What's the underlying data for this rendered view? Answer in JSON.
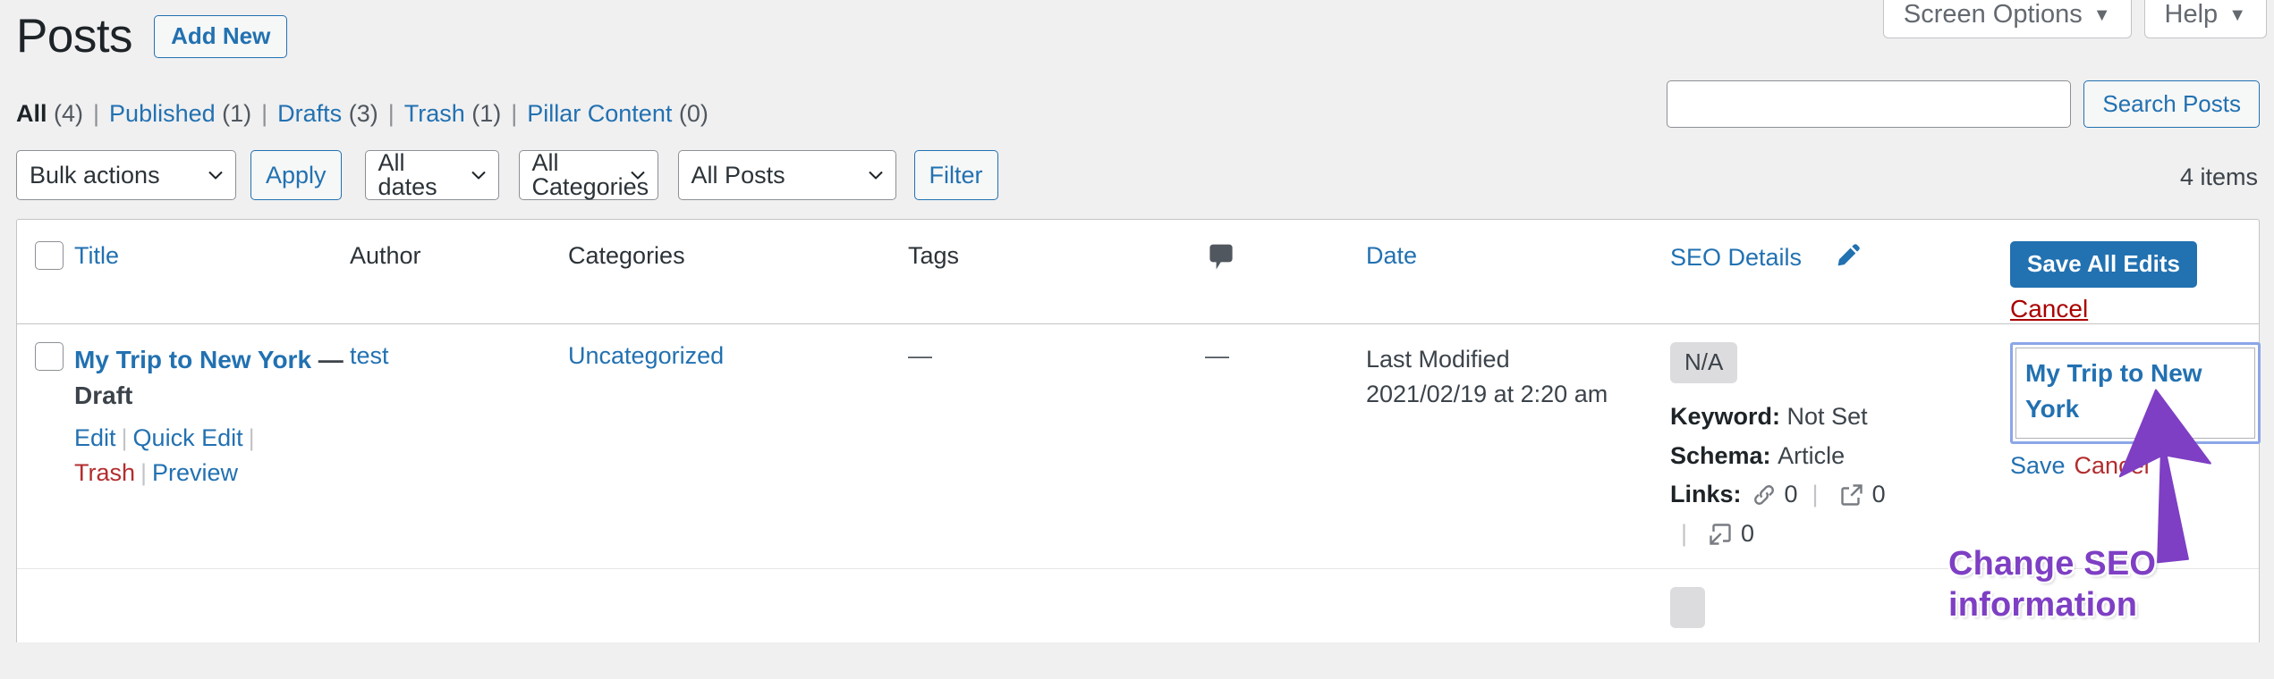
{
  "screen_meta": {
    "screen_options_label": "Screen Options",
    "help_label": "Help",
    "caret": "▼"
  },
  "header": {
    "page_title": "Posts",
    "add_new_label": "Add New"
  },
  "status_filters": [
    {
      "label": "All",
      "count": "(4)",
      "current": true
    },
    {
      "label": "Published",
      "count": "(1)",
      "current": false
    },
    {
      "label": "Drafts",
      "count": "(3)",
      "current": false
    },
    {
      "label": "Trash",
      "count": "(1)",
      "current": false
    },
    {
      "label": "Pillar Content",
      "count": "(0)",
      "current": false
    }
  ],
  "search": {
    "value": "",
    "placeholder": "",
    "submit_label": "Search Posts"
  },
  "tablenav": {
    "bulk_actions": "Bulk actions",
    "apply_label": "Apply",
    "all_dates": "All dates",
    "all_categories": "All Categories",
    "all_posts": "All Posts",
    "filter_label": "Filter",
    "items_count": "4 items"
  },
  "table": {
    "columns": {
      "title": "Title",
      "author": "Author",
      "categories": "Categories",
      "tags": "Tags",
      "comments_icon": "comment-bubble-icon",
      "date": "Date",
      "seo_details": "SEO Details",
      "edit_icon": "pencil-icon"
    },
    "bulk_edit": {
      "save_all_label": "Save All Edits",
      "cancel_label": "Cancel"
    },
    "rows": [
      {
        "title": "My Trip to New York",
        "state": "— Draft",
        "actions": {
          "edit": "Edit",
          "quick_edit": "Quick Edit",
          "trash": "Trash",
          "preview": "Preview"
        },
        "author": "test",
        "categories": "Uncategorized",
        "tags": "—",
        "comments": "—",
        "date_label": "Last Modified",
        "date_value": "2021/02/19 at 2:20 am",
        "seo": {
          "score_badge": "N/A",
          "keyword_label": "Keyword:",
          "keyword_value": "Not Set",
          "schema_label": "Schema:",
          "schema_value": "Article",
          "links_label": "Links:",
          "internal_links": "0",
          "external_links": "0",
          "inbound_links": "0"
        },
        "inline_edit": {
          "value": "My Trip to New York",
          "save_label": "Save",
          "cancel_label": "Cancel"
        }
      }
    ]
  },
  "annotation": {
    "text": "Change SEO information",
    "color": "#7e3fc4"
  },
  "colors": {
    "accent_blue": "#2271b1",
    "link_blue": "#2271b1",
    "danger_red": "#b32d2e",
    "page_bg": "#f0f0f1",
    "badge_grey": "#dcdcde"
  }
}
